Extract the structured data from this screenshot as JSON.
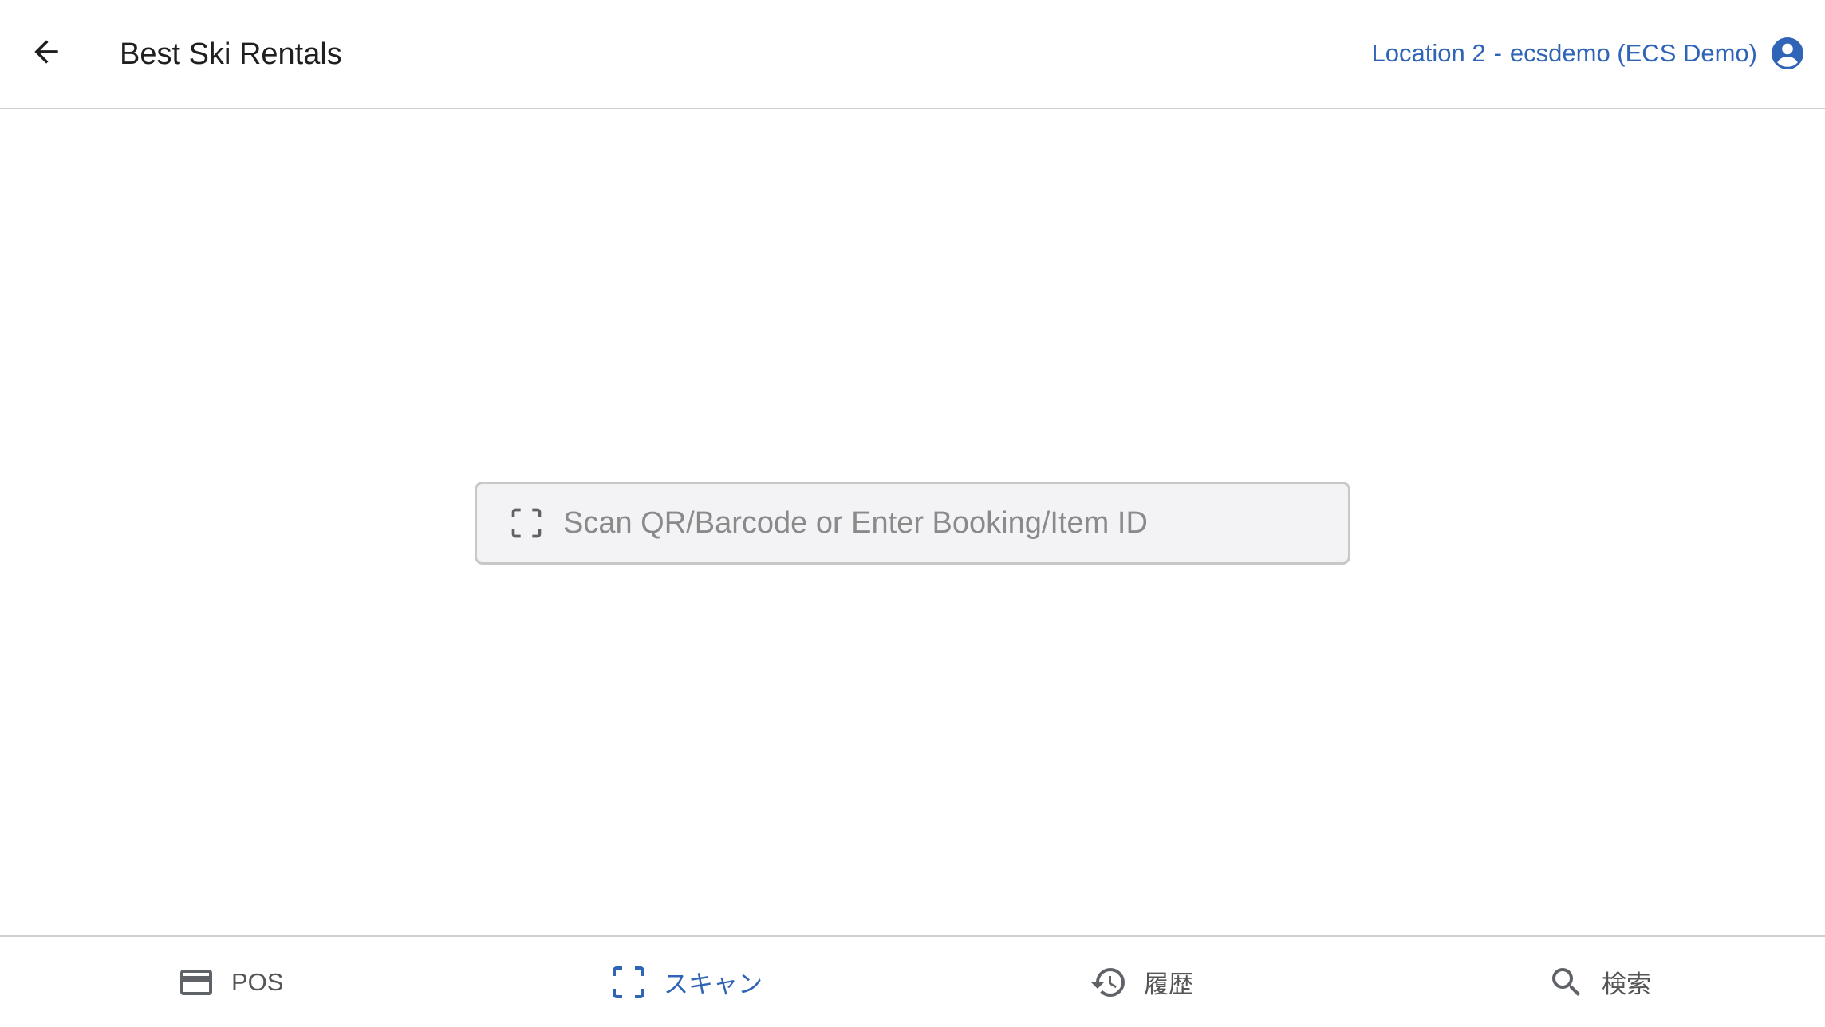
{
  "header": {
    "title": "Best Ski Rentals",
    "location": "Location 2",
    "separator": "-",
    "account": "ecsdemo (ECS Demo)"
  },
  "scan": {
    "placeholder": "Scan QR/Barcode or Enter Booking/Item ID",
    "value": ""
  },
  "nav": {
    "items": [
      {
        "label": "POS",
        "icon": "credit-card-icon"
      },
      {
        "label": "スキャン",
        "icon": "scan-frame-icon",
        "active": true
      },
      {
        "label": "履歴",
        "icon": "history-icon"
      },
      {
        "label": "検索",
        "icon": "search-icon"
      }
    ]
  },
  "colors": {
    "accent": "#2f64b6",
    "icon_gray": "#5f6368",
    "text_dark": "#1f1f1f",
    "divider": "#cfcfcf",
    "field_bg": "#f3f3f5"
  }
}
